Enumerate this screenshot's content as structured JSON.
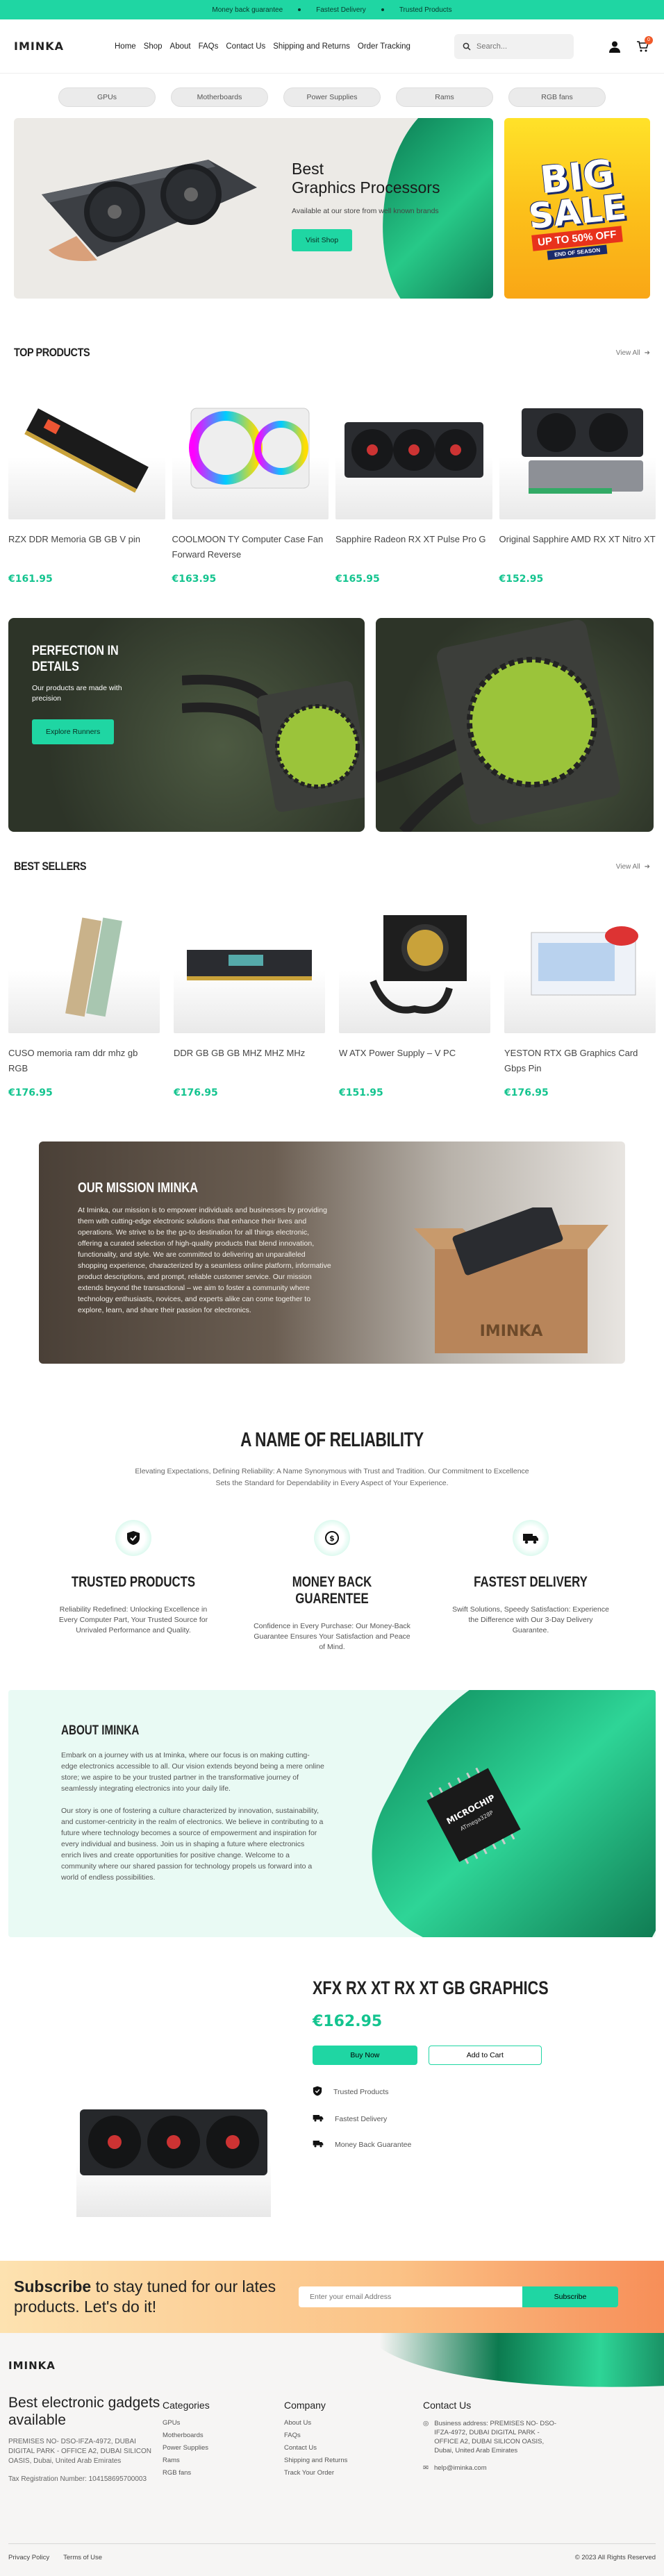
{
  "topbar": {
    "items": [
      "Money back guarantee",
      "Fastest Delivery",
      "Trusted Products"
    ]
  },
  "header": {
    "logo": "IMINKA",
    "nav": [
      "Home",
      "Shop",
      "About",
      "FAQs",
      "Contact Us",
      "Shipping and Returns",
      "Order Tracking"
    ],
    "search_placeholder": "Search...",
    "cart_count": "0"
  },
  "categories": [
    "GPUs",
    "Motherboards",
    "Power Supplies",
    "Rams",
    "RGB fans"
  ],
  "hero": {
    "title_line1": "Best",
    "title_line2": "Graphics Processors",
    "subtitle": "Available at our store from well known brands",
    "cta": "Visit Shop",
    "sale": {
      "big": "BIG",
      "sale": "SALE",
      "offer": "UP TO 50% OFF",
      "season": "END OF SEASON"
    }
  },
  "top_products": {
    "title": "TOP PRODUCTS",
    "view_all": "View All",
    "items": [
      {
        "name": "RZX DDR Memoria GB GB V pin",
        "price": "€161.95"
      },
      {
        "name": "COOLMOON TY Computer Case Fan Forward Reverse",
        "price": "€163.95"
      },
      {
        "name": "Sapphire Radeon RX XT Pulse Pro G",
        "price": "€165.95"
      },
      {
        "name": "Original Sapphire AMD RX XT Nitro XT",
        "price": "€152.95"
      }
    ]
  },
  "promo": {
    "title_line1": "PERFECTION IN",
    "title_line2": "DETAILS",
    "text": "Our products are made with precision",
    "cta": "Explore Runners"
  },
  "best_sellers": {
    "title": "BEST SELLERS",
    "view_all": "View All",
    "items": [
      {
        "name": "CUSO memoria ram ddr mhz gb RGB",
        "price": "€176.95"
      },
      {
        "name": "DDR GB GB GB MHZ MHZ MHz",
        "price": "€176.95"
      },
      {
        "name": "W ATX Power Supply – V PC",
        "price": "€151.95"
      },
      {
        "name": "YESTON RTX GB Graphics Card Gbps Pin",
        "price": "€176.95"
      }
    ]
  },
  "mission": {
    "title": "OUR MISSION IMINKA",
    "text": "At Iminka, our mission is to empower individuals and businesses by providing them with cutting-edge electronic solutions that enhance their lives and operations. We strive to be the go-to destination for all things electronic, offering a curated selection of high-quality products that blend innovation, functionality, and style. We are committed to delivering an unparalleled shopping experience, characterized by a seamless online platform, informative product descriptions, and prompt, reliable customer service. Our mission extends beyond the transactional – we aim to foster a community where technology enthusiasts, novices, and experts alike can come together to explore, learn, and share their passion for electronics.",
    "box_text": "IMINKA"
  },
  "reliability": {
    "title": "A NAME OF RELIABILITY",
    "subtitle": "Elevating Expectations, Defining Reliability: A Name Synonymous with Trust and Tradition. Our Commitment to Excellence Sets the Standard for Dependability in Every Aspect of Your Experience.",
    "features": [
      {
        "icon": "shield-check-icon",
        "title": "TRUSTED PRODUCTS",
        "text": "Reliability Redefined: Unlocking Excellence in Every Computer Part, Your Trusted Source for Unrivaled Performance and Quality."
      },
      {
        "icon": "money-back-icon",
        "title": "MONEY BACK GUARENTEE",
        "text": "Confidence in Every Purchase: Our Money-Back Guarantee Ensures Your Satisfaction and Peace of Mind."
      },
      {
        "icon": "truck-icon",
        "title": "FASTEST DELIVERY",
        "text": "Swift Solutions, Speedy Satisfaction: Experience the Difference with Our 3-Day Delivery Guarantee."
      }
    ]
  },
  "about": {
    "title": "ABOUT IMINKA",
    "p1": "Embark on a journey with us at Iminka, where our focus is on making cutting-edge electronics accessible to all. Our vision extends beyond being a mere online store; we aspire to be your trusted partner in the transformative journey of seamlessly integrating electronics into your daily life.",
    "p2": "Our story is one of fostering a culture characterized by innovation, sustainability, and customer-centricity in the realm of electronics. We believe in contributing to a future where technology becomes a source of empowerment and inspiration for every individual and business. Join us in shaping a future where electronics enrich lives and create opportunities for positive change. Welcome to a community where our shared passion for technology propels us forward into a world of endless possibilities.",
    "chip_brand": "MICROCHIP",
    "chip_model": "ATmega328P"
  },
  "featured": {
    "title": "XFX RX XT RX XT GB GRAPHICS",
    "price": "€162.95",
    "buy": "Buy Now",
    "cart": "Add to Cart",
    "perks": [
      "Trusted Products",
      "Fastest Delivery",
      "Money Back Guarantee"
    ]
  },
  "subscribe": {
    "bold": "Subscribe",
    "rest": " to stay tuned for our lates products. Let's do it!",
    "placeholder": "Enter your email Address",
    "button": "Subscribe"
  },
  "footer": {
    "logo": "IMINKA",
    "tagline": "Best electronic gadgets available",
    "address": "PREMISES NO- DSO-IFZA-4972, DUBAI DIGITAL PARK - OFFICE A2, DUBAI SILICON OASIS, Dubai, United Arab Emirates",
    "tax": "Tax Registration Number: 104158695700003",
    "categories_title": "Categories",
    "categories": [
      "GPUs",
      "Motherboards",
      "Power Supplies",
      "Rams",
      "RGB fans"
    ],
    "company_title": "Company",
    "company": [
      "About Us",
      "FAQs",
      "Contact Us",
      "Shipping and Returns",
      "Track Your Order"
    ],
    "contact_title": "Contact Us",
    "contact_address": "Business address: PREMISES NO- DSO-IFZA-4972, DUBAI DIGITAL PARK - OFFICE A2, DUBAI SILICON OASIS, Dubai, United Arab Emirates",
    "email": "help@iminka.com",
    "privacy": "Privacy Policy",
    "terms": "Terms of Use",
    "copyright": "© 2023 All Rights Reserved"
  }
}
